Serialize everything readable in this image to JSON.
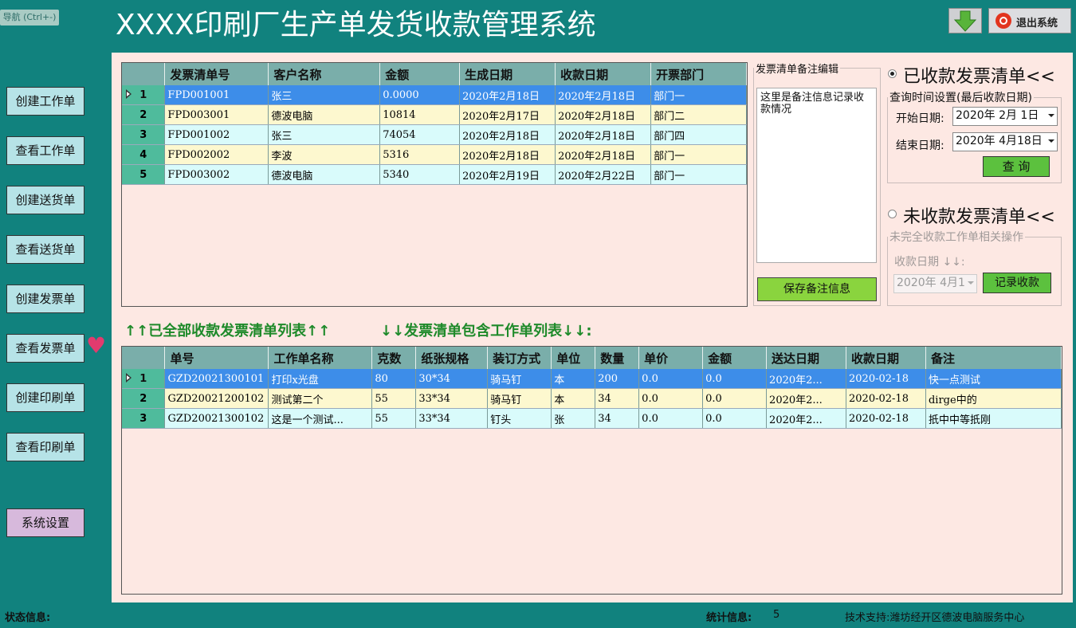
{
  "nav_button": "导航 (Ctrl+-)",
  "app_title": "XXXX印刷厂生产单发货收款管理系统",
  "top_right": {
    "download_icon": "green-down-arrow-icon",
    "exit_label": "退出系统",
    "exit_icon": "power-icon"
  },
  "sidebar": {
    "items": [
      {
        "label": "创建工作单"
      },
      {
        "label": "查看工作单"
      },
      {
        "label": "创建送货单"
      },
      {
        "label": "查看送货单"
      },
      {
        "label": "创建发票单"
      },
      {
        "label": "查看发票单"
      },
      {
        "label": "创建印刷单"
      },
      {
        "label": "查看印刷单"
      }
    ],
    "settings": "系统设置",
    "marker_icon": "heart-icon"
  },
  "invoice_grid": {
    "columns": [
      "发票清单号",
      "客户名称",
      "金额",
      "生成日期",
      "收款日期",
      "开票部门"
    ],
    "rows": [
      {
        "n": "1",
        "cells": [
          "FPD001001",
          "张三",
          "0.0000",
          "2020年2月18日",
          "2020年2月18日",
          "部门一"
        ]
      },
      {
        "n": "2",
        "cells": [
          "FPD003001",
          "德波电脑",
          "10814",
          "2020年2月17日",
          "2020年2月18日",
          "部门二"
        ]
      },
      {
        "n": "3",
        "cells": [
          "FPD001002",
          "张三",
          "74054",
          "2020年2月18日",
          "2020年2月18日",
          "部门四"
        ]
      },
      {
        "n": "4",
        "cells": [
          "FPD002002",
          "李波",
          "5316",
          "2020年2月18日",
          "2020年2月18日",
          "部门一"
        ]
      },
      {
        "n": "5",
        "cells": [
          "FPD003002",
          "德波电脑",
          "5340",
          "2020年2月19日",
          "2020年2月22日",
          "部门一"
        ]
      }
    ]
  },
  "memo": {
    "legend": "发票清单备注编辑",
    "text": "这里是备注信息记录收款情况",
    "save_button": "保存备注信息"
  },
  "paid": {
    "radio_label": "已收款发票清单<<",
    "group_legend": "查询时间设置(最后收款日期)",
    "start_label": "开始日期:",
    "start_value": "2020年  2月  1日",
    "end_label": "结束日期:",
    "end_value": "2020年  4月18日",
    "query_button": "查 询"
  },
  "unpaid": {
    "radio_label": "未收款发票清单<<",
    "group_legend": "未完全收款工作单相关操作",
    "date_label": "收款日期 ↓↓:",
    "date_value": "2020年  4月1",
    "record_button": "记录收款"
  },
  "captions": {
    "left": "↑↑已全部收款发票清单列表↑↑",
    "right": "↓↓发票清单包含工作单列表↓↓:"
  },
  "work_grid": {
    "columns": [
      "单号",
      "工作单名称",
      "克数",
      "纸张规格",
      "装订方式",
      "单位",
      "数量",
      "单价",
      "金额",
      "送达日期",
      "收款日期",
      "备注"
    ],
    "rows": [
      {
        "n": "1",
        "cells": [
          "GZD20021300101",
          "打印x光盘",
          "80",
          "30*34",
          "骑马钉",
          "本",
          "200",
          "0.0",
          "0.0",
          "2020年2...",
          "2020-02-18",
          "快一点测试"
        ]
      },
      {
        "n": "2",
        "cells": [
          "GZD20021200102",
          "测试第二个",
          "55",
          "33*34",
          "骑马钉",
          "本",
          "34",
          "0.0",
          "0.0",
          "2020年2...",
          "2020-02-18",
          "dirge中的"
        ]
      },
      {
        "n": "3",
        "cells": [
          "GZD20021300102",
          "这是一个测试...",
          "55",
          "33*34",
          "钉头",
          "张",
          "34",
          "0.0",
          "0.0",
          "2020年2...",
          "2020-02-18",
          "扺中中等扺刚"
        ]
      }
    ]
  },
  "status": {
    "label": "状态信息:",
    "stats_label": "统计信息:",
    "stats_value": "5",
    "support": "技术支持:潍坊经开区德波电脑服务中心"
  }
}
